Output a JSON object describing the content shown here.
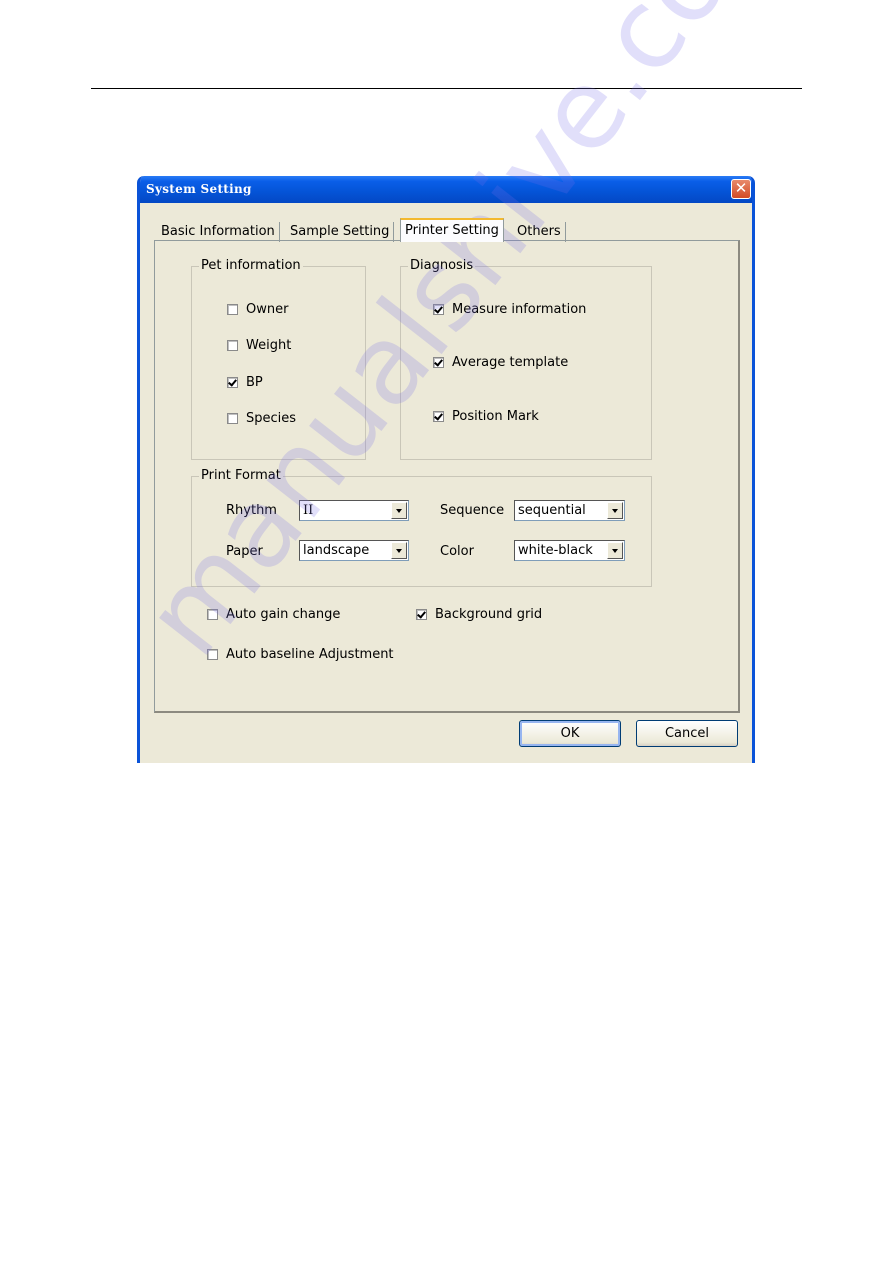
{
  "window": {
    "title": "System Setting",
    "close_icon": "close-icon"
  },
  "tabs": [
    {
      "label": "Basic Information",
      "active": false
    },
    {
      "label": "Sample Setting",
      "active": false
    },
    {
      "label": "Printer Setting",
      "active": true
    },
    {
      "label": "Others",
      "active": false
    }
  ],
  "pet_information": {
    "legend": "Pet information",
    "items": [
      {
        "label": "Owner",
        "checked": false
      },
      {
        "label": "Weight",
        "checked": false
      },
      {
        "label": "BP",
        "checked": true
      },
      {
        "label": "Species",
        "checked": false
      }
    ]
  },
  "diagnosis": {
    "legend": "Diagnosis",
    "items": [
      {
        "label": "Measure information",
        "checked": true
      },
      {
        "label": "Average template",
        "checked": true
      },
      {
        "label": "Position Mark",
        "checked": true
      }
    ]
  },
  "print_format": {
    "legend": "Print Format",
    "rhythm": {
      "label": "Rhythm",
      "value": "II"
    },
    "sequence": {
      "label": "Sequence",
      "value": "sequential"
    },
    "paper": {
      "label": "Paper",
      "value": "landscape"
    },
    "color": {
      "label": "Color",
      "value": "white-black"
    }
  },
  "options": [
    {
      "label": "Auto gain change",
      "checked": false
    },
    {
      "label": "Background grid",
      "checked": true
    },
    {
      "label": "Auto baseline Adjustment",
      "checked": false
    }
  ],
  "buttons": {
    "ok": "OK",
    "cancel": "Cancel"
  },
  "watermark": "manualshive.com"
}
